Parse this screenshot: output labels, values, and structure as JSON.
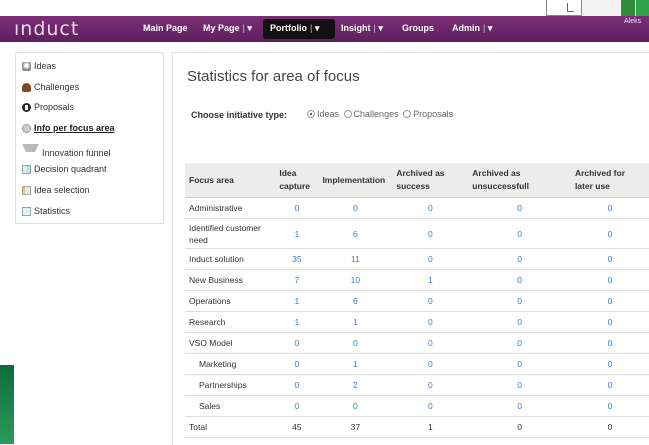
{
  "app": {
    "logo_text": "ınduct",
    "user_name": "Aleks"
  },
  "nav": {
    "items": [
      {
        "label": "Main Page",
        "has_menu": false
      },
      {
        "label": "My Page",
        "has_menu": true,
        "sep": "|",
        "chev": "▾"
      },
      {
        "label": "Portfolio",
        "has_menu": true,
        "sep": "|",
        "chev": "▾",
        "active": true
      },
      {
        "label": "Insight",
        "has_menu": true,
        "sep": "|",
        "chev": "▾"
      },
      {
        "label": "Groups",
        "has_menu": false
      },
      {
        "label": "Admin",
        "has_menu": true,
        "sep": "|",
        "chev": "▾"
      }
    ]
  },
  "sidebar": {
    "items": [
      {
        "label": "Ideas",
        "icon": "lightbulb-icon"
      },
      {
        "label": "Challenges",
        "icon": "trophy-icon"
      },
      {
        "label": "Proposals",
        "icon": "proposal-icon"
      },
      {
        "label": "Info per focus area",
        "icon": "focus-area-icon",
        "active": true
      },
      {
        "label": "Innovation funnel",
        "icon": "funnel-icon"
      },
      {
        "label": "Decision quadrant",
        "icon": "quadrant-icon"
      },
      {
        "label": "Idea selection",
        "icon": "selection-icon"
      },
      {
        "label": "Statistics",
        "icon": "statistics-icon"
      }
    ]
  },
  "main": {
    "title": "Statistics for area of focus",
    "choose_label": "Choose initiative type:",
    "radio_options": [
      {
        "label": "Ideas",
        "selected": true
      },
      {
        "label": "Challenges",
        "selected": false
      },
      {
        "label": "Proposals",
        "selected": false
      }
    ]
  },
  "table": {
    "headers": [
      "Focus area",
      "Idea capture",
      "Implementation",
      "Archived as success",
      "Archived as unsuccessfull",
      "Archived for later use"
    ],
    "rows": [
      {
        "area": "Administrative",
        "values": [
          "0",
          "0",
          "0",
          "0",
          "0"
        ]
      },
      {
        "area": "Identified customer need",
        "values": [
          "1",
          "6",
          "0",
          "0",
          "0"
        ]
      },
      {
        "area": "Induct solution",
        "values": [
          "35",
          "11",
          "0",
          "0",
          "0"
        ]
      },
      {
        "area": "New Business",
        "values": [
          "7",
          "10",
          "1",
          "0",
          "0"
        ]
      },
      {
        "area": "Operations",
        "values": [
          "1",
          "6",
          "0",
          "0",
          "0"
        ]
      },
      {
        "area": "Research",
        "values": [
          "1",
          "1",
          "0",
          "0",
          "0"
        ]
      },
      {
        "area": "VSO Model",
        "values": [
          "0",
          "0",
          "0",
          "0",
          "0"
        ]
      },
      {
        "area": "Marketing",
        "values": [
          "0",
          "1",
          "0",
          "0",
          "0"
        ]
      },
      {
        "area": "Partnerships",
        "values": [
          "0",
          "2",
          "0",
          "0",
          "0"
        ]
      },
      {
        "area": "Sales",
        "values": [
          "0",
          "0",
          "0",
          "0",
          "0"
        ]
      }
    ],
    "total": {
      "area": "Total",
      "values": [
        "45",
        "37",
        "1",
        "0",
        "0"
      ]
    }
  },
  "colors": {
    "nav_bg": "#6b2669",
    "link_blue": "#3a7bd5",
    "header_bg": "#ececec"
  }
}
